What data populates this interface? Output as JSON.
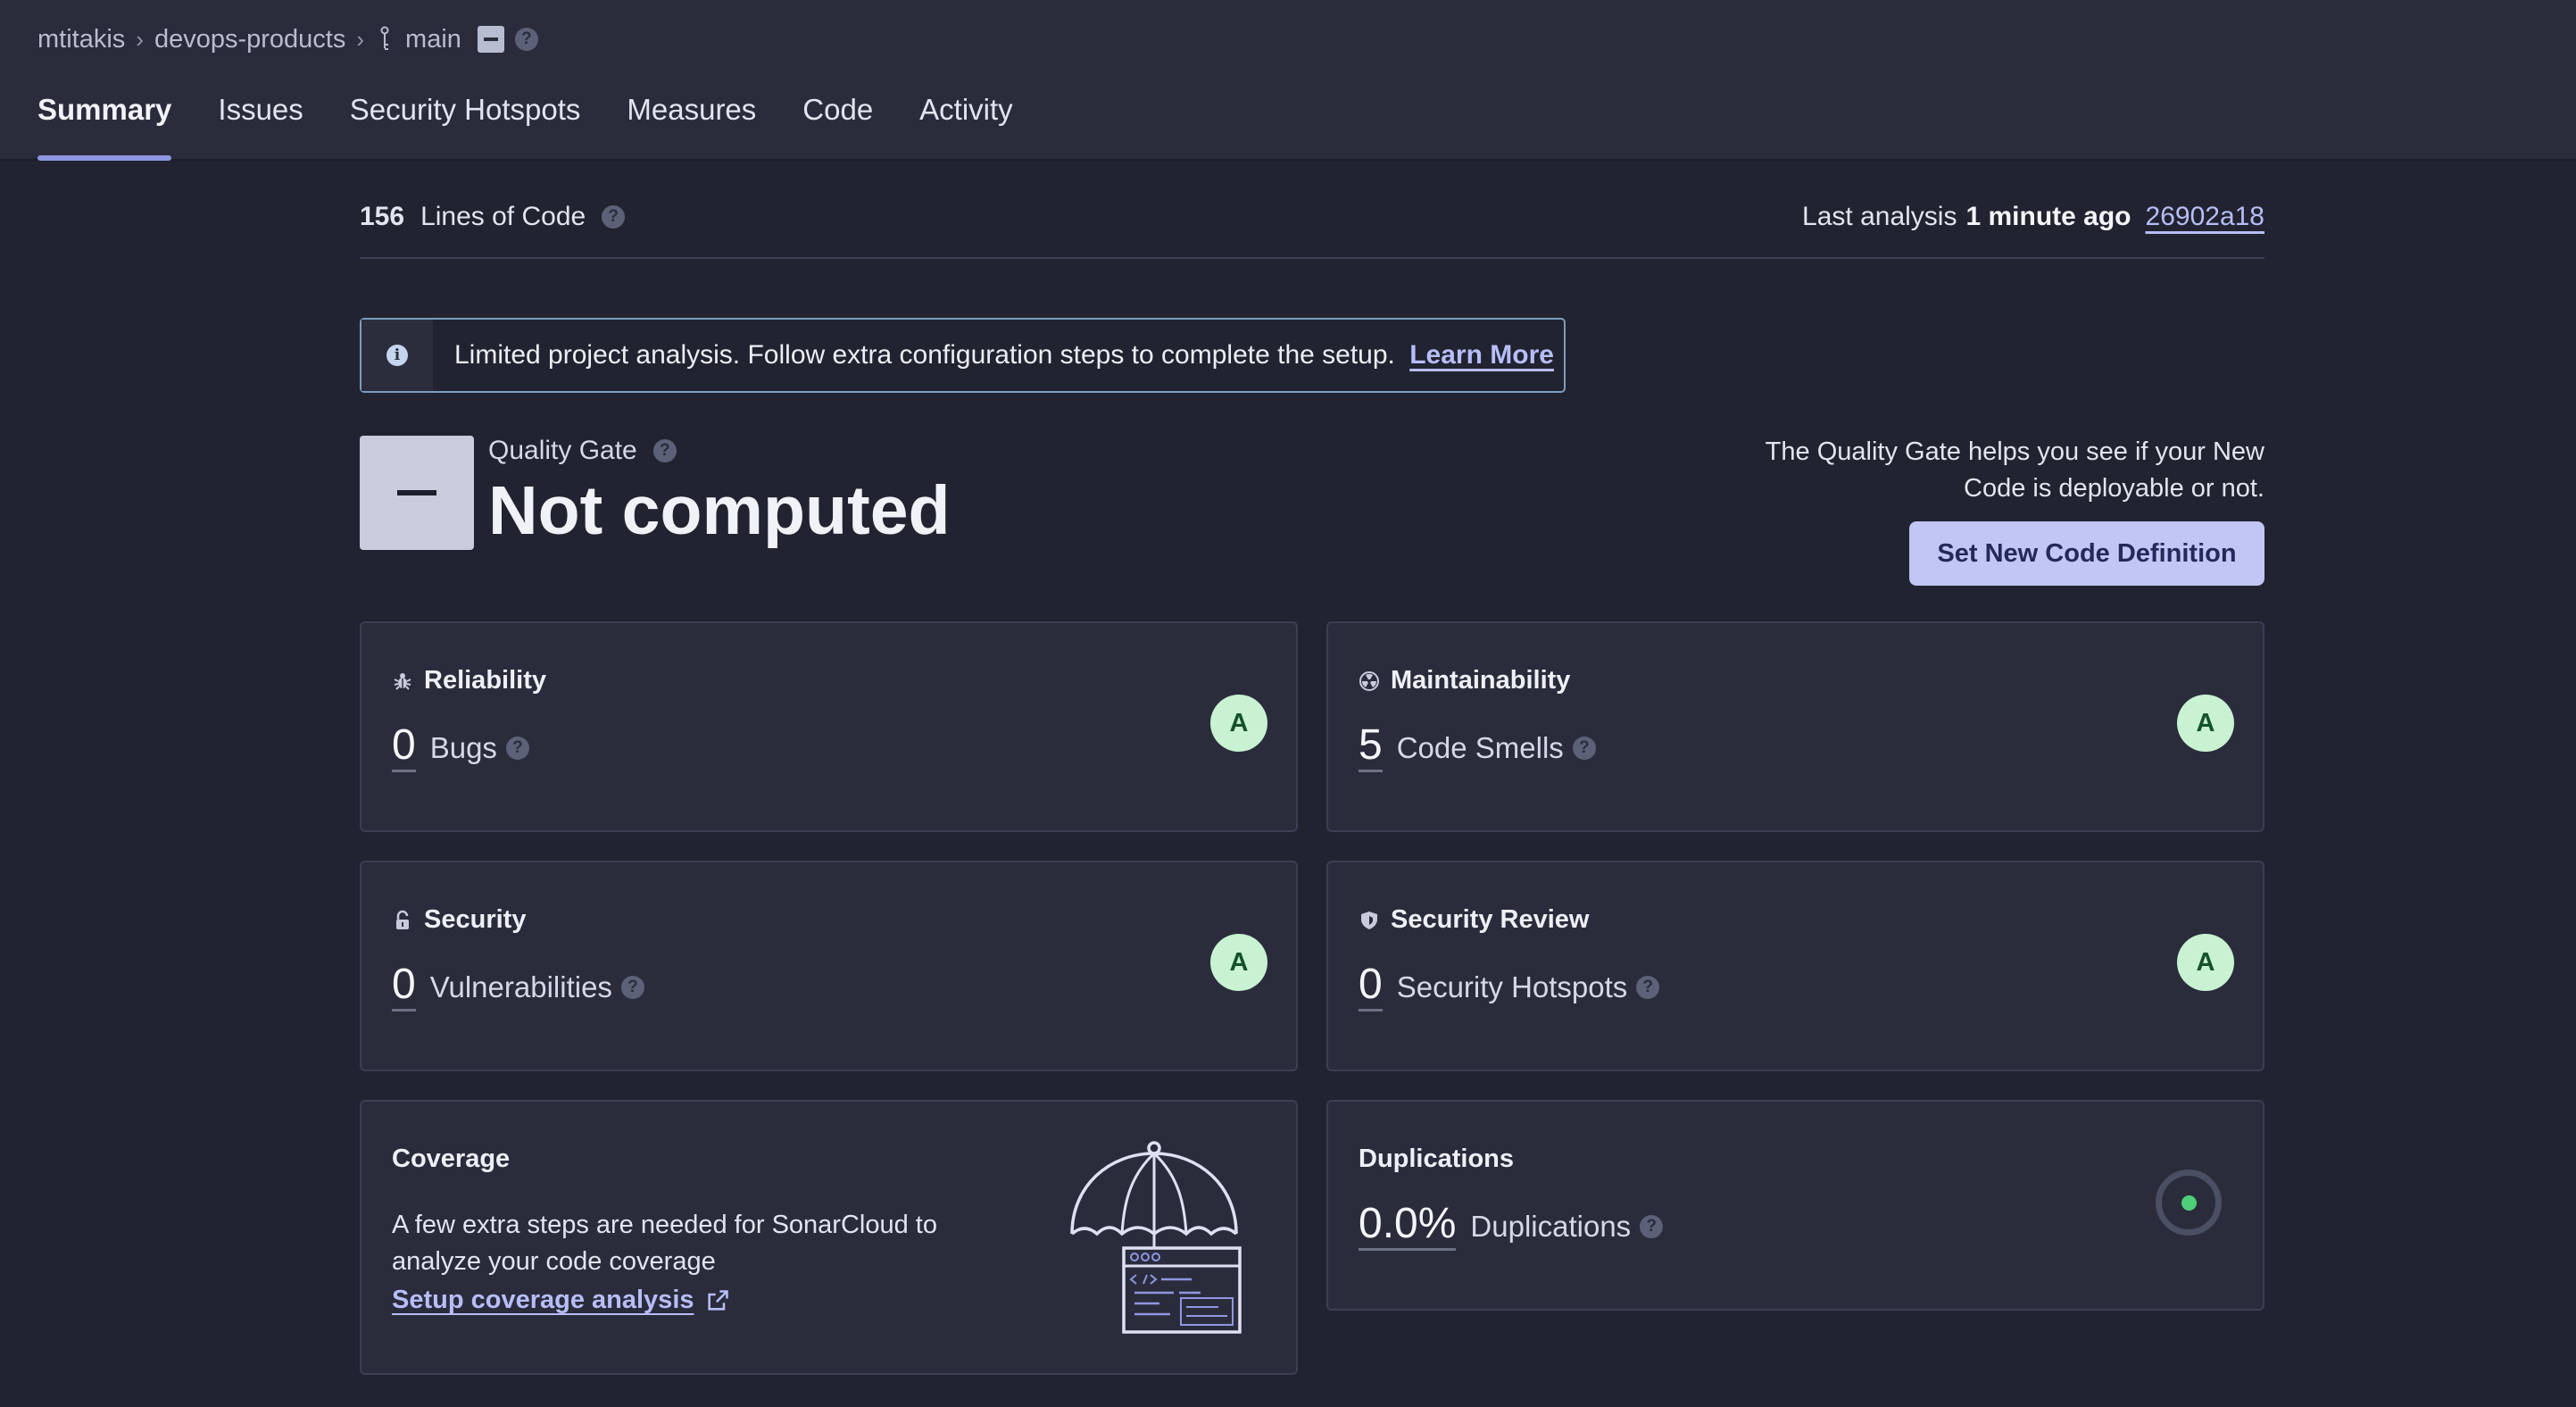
{
  "breadcrumb": {
    "organization": "mtitakis",
    "project": "devops-products",
    "branch": "main"
  },
  "tabs": [
    {
      "label": "Summary",
      "active": true
    },
    {
      "label": "Issues"
    },
    {
      "label": "Security Hotspots"
    },
    {
      "label": "Measures"
    },
    {
      "label": "Code"
    },
    {
      "label": "Activity"
    }
  ],
  "summary": {
    "lines_of_code": "156",
    "lines_label": "Lines of Code",
    "last_analysis_label": "Last analysis",
    "last_analysis_time": "1 minute ago",
    "commit": "26902a18"
  },
  "banner": {
    "text": "Limited project analysis. Follow extra configuration steps to complete the setup.",
    "link": "Learn More"
  },
  "quality_gate": {
    "label": "Quality Gate",
    "status": "Not computed",
    "help": "The Quality Gate helps you see if your New Code is deployable or not.",
    "button": "Set New Code Definition"
  },
  "cards": {
    "reliability": {
      "title": "Reliability",
      "value": "0",
      "label": "Bugs",
      "rating": "A"
    },
    "maintainability": {
      "title": "Maintainability",
      "value": "5",
      "label": "Code Smells",
      "rating": "A"
    },
    "security": {
      "title": "Security",
      "value": "0",
      "label": "Vulnerabilities",
      "rating": "A"
    },
    "security_review": {
      "title": "Security Review",
      "value": "0",
      "label": "Security Hotspots",
      "rating": "A"
    },
    "coverage": {
      "title": "Coverage",
      "text": "A few extra steps are needed for SonarCloud to analyze your code coverage",
      "link": "Setup coverage analysis"
    },
    "duplications": {
      "title": "Duplications",
      "value": "0.0%",
      "label": "Duplications"
    }
  },
  "colors": {
    "background": "#212330",
    "header": "#2a2c3b",
    "accent": "#8f96e0",
    "link": "#b7bdf7",
    "rating_a_bg": "#c8f2d2",
    "rating_a_text": "#15512d",
    "duplication_dot": "#4fcf7a"
  },
  "icons": {
    "branch": "git-branch-icon",
    "help": "question-mark-icon",
    "info": "info-icon",
    "reliability": "bug-icon",
    "maintainability": "radiation-icon",
    "security": "lock-icon",
    "security_review": "shield-icon",
    "external": "external-link-icon"
  }
}
